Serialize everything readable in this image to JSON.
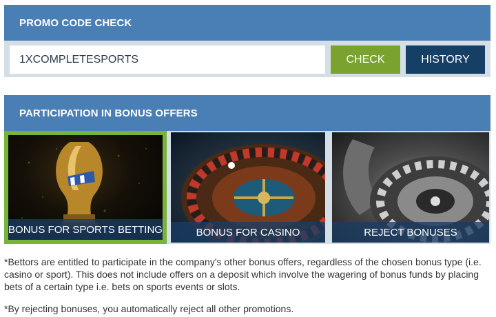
{
  "promo": {
    "title": "PROMO CODE CHECK",
    "code_value": "1XCOMPLETESPORTS",
    "check_label": "CHECK",
    "history_label": "HISTORY"
  },
  "bonus": {
    "title": "PARTICIPATION IN BONUS OFFERS",
    "offers": [
      {
        "label": "BONUS FOR SPORTS BETTING",
        "selected": true
      },
      {
        "label": "BONUS FOR CASINO",
        "selected": false
      },
      {
        "label": "REJECT BONUSES",
        "selected": false
      }
    ]
  },
  "notes": {
    "note1": "*Bettors are entitled to participate in the company's other bonus offers, regardless of the chosen bonus type (i.e. casino or sport). This does not include offers on a deposit which involve the wagering of bonus funds by placing bets of a certain type i.e. bets on sports events or slots.",
    "note2": "*By rejecting bonuses, you automatically reject all other promotions."
  },
  "colors": {
    "header_blue": "#4a7fb5",
    "check_green": "#79a32e",
    "history_navy": "#163f66",
    "selected_border": "#78b33a"
  }
}
